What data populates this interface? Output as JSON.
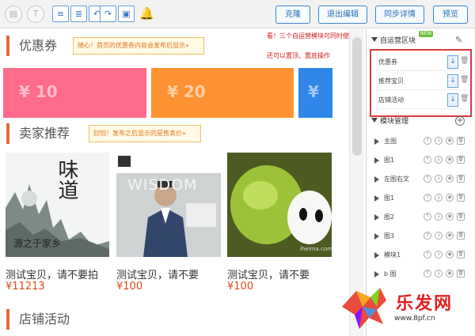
{
  "toolbar": {
    "icons": [
      "layout-icon",
      "text-icon",
      "align-left-icon",
      "align-right-icon",
      "undo-icon",
      "redo-icon",
      "save-icon",
      "bell-icon"
    ],
    "buttons": {
      "clone": "克隆",
      "exit_edit": "退出编辑",
      "sync_detail": "同步详情",
      "preview": "预览"
    }
  },
  "canvas": {
    "coupons": {
      "title": "优惠券",
      "hint": "随心！首页的优惠券内容会发布后显示»",
      "values": [
        "¥ 10",
        "¥ 20",
        "¥"
      ],
      "colors": [
        "#ff6b8b",
        "#ff9233",
        "#2f86e8"
      ]
    },
    "seller_recommend": {
      "title": "卖家推荐",
      "hint": "别怕！发布之后显示的是售卖价»",
      "products": [
        {
          "name": "测试宝贝，请不要拍",
          "price": "¥11213",
          "image_caption": "源之于家乡",
          "image_title": "味道"
        },
        {
          "name": "测试宝贝，请不要",
          "price": "¥100",
          "image_caption": "",
          "image_title": "WISDOM"
        },
        {
          "name": "测试宝贝，请不要",
          "price": "¥100",
          "image_caption": "iheima.com",
          "image_title": ""
        }
      ]
    },
    "shop_activity": {
      "title": "店铺活动"
    },
    "overlay_notes": {
      "line1": "看！三个自运营模块可同时使用！",
      "line2": "还可以置顶、置底操作"
    }
  },
  "panel": {
    "custom_section": {
      "title": "自运营区块",
      "badge": "NEW",
      "items": [
        "优惠券",
        "推荐宝贝",
        "店铺活动"
      ]
    },
    "module_section": {
      "title": "模块管理",
      "items": [
        "主图",
        "图1",
        "左图右文",
        "图1",
        "图2",
        "图3",
        "模块1",
        "b 图"
      ]
    }
  },
  "watermark": {
    "brand": "乐发网",
    "url": "www.8pf.cn"
  }
}
